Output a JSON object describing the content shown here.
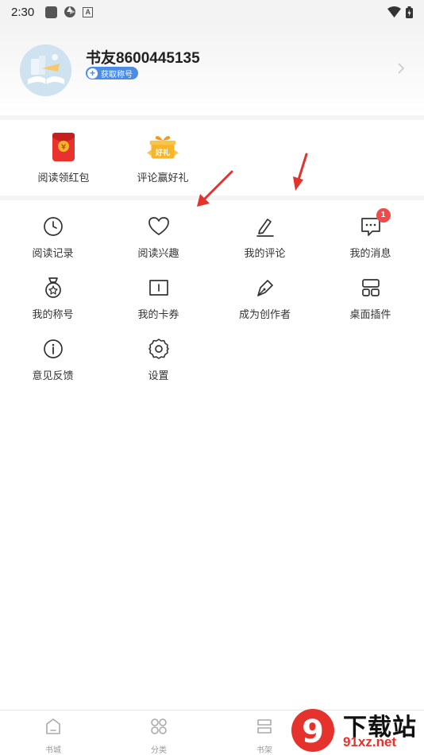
{
  "status_bar": {
    "time": "2:30",
    "letter_icon": "A"
  },
  "profile": {
    "username": "书友8600445135",
    "title_badge_icon": "+",
    "title_badge": "获取称号"
  },
  "promos": [
    {
      "label": "阅读领红包",
      "icon": "red-envelope-icon",
      "glyph": "¥"
    },
    {
      "label": "评论赢好礼",
      "icon": "gift-box-icon",
      "glyph": "好礼"
    }
  ],
  "menu": [
    {
      "label": "阅读记录",
      "icon": "clock-icon"
    },
    {
      "label": "阅读兴趣",
      "icon": "heart-icon"
    },
    {
      "label": "我的评论",
      "icon": "pencil-icon"
    },
    {
      "label": "我的消息",
      "icon": "message-icon",
      "badge": "1"
    },
    {
      "label": "我的称号",
      "icon": "medal-icon"
    },
    {
      "label": "我的卡券",
      "icon": "coupon-icon"
    },
    {
      "label": "成为创作者",
      "icon": "pen-nib-icon"
    },
    {
      "label": "桌面插件",
      "icon": "widget-icon"
    },
    {
      "label": "意见反馈",
      "icon": "info-icon"
    },
    {
      "label": "设置",
      "icon": "gear-icon"
    }
  ],
  "tabs": [
    {
      "label": "书城",
      "icon": "home-icon"
    },
    {
      "label": "分类",
      "icon": "category-icon"
    },
    {
      "label": "书架",
      "icon": "bookshelf-icon"
    }
  ],
  "watermark": {
    "logo_glyph": "9",
    "line1": "下载站",
    "line2": "91xz.net"
  },
  "colors": {
    "accent_blue": "#4a8ce8",
    "badge_red": "#f04a4a",
    "envelope_red": "#e8322d",
    "gift_yellow": "#f7b52c"
  }
}
